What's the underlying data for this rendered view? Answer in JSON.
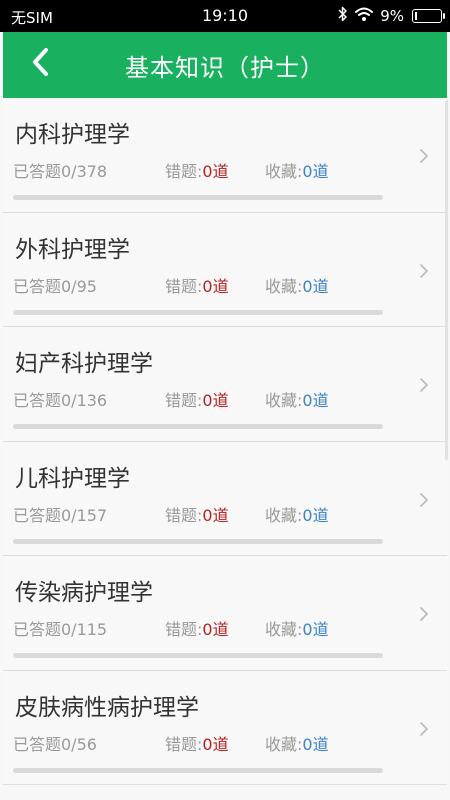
{
  "status_bar": {
    "carrier": "无SIM",
    "time": "19:10",
    "battery_percent": "9%",
    "battery_level": 0.09,
    "icons": [
      "bluetooth-icon",
      "wifi-icon",
      "battery-icon"
    ]
  },
  "header": {
    "title": "基本知识（护士）",
    "back_icon": "chevron-left-icon",
    "background": "#19b05f"
  },
  "stat_labels": {
    "answered_prefix": "已答题",
    "wrong_label": "错题:",
    "fav_label": "收藏:",
    "unit": "道"
  },
  "colors": {
    "accent": "#19b05f",
    "wrong": "#b82121",
    "favorite": "#3b83c6"
  },
  "subjects": [
    {
      "name": "内科护理学",
      "answered": "已答题0/378",
      "wrong": "0道",
      "favorites": "0道",
      "progress": 0
    },
    {
      "name": "外科护理学",
      "answered": "已答题0/95",
      "wrong": "0道",
      "favorites": "0道",
      "progress": 0
    },
    {
      "name": "妇产科护理学",
      "answered": "已答题0/136",
      "wrong": "0道",
      "favorites": "0道",
      "progress": 0
    },
    {
      "name": "儿科护理学",
      "answered": "已答题0/157",
      "wrong": "0道",
      "favorites": "0道",
      "progress": 0
    },
    {
      "name": "传染病护理学",
      "answered": "已答题0/115",
      "wrong": "0道",
      "favorites": "0道",
      "progress": 0
    },
    {
      "name": "皮肤病性病护理学",
      "answered": "已答题0/56",
      "wrong": "0道",
      "favorites": "0道",
      "progress": 0
    }
  ]
}
